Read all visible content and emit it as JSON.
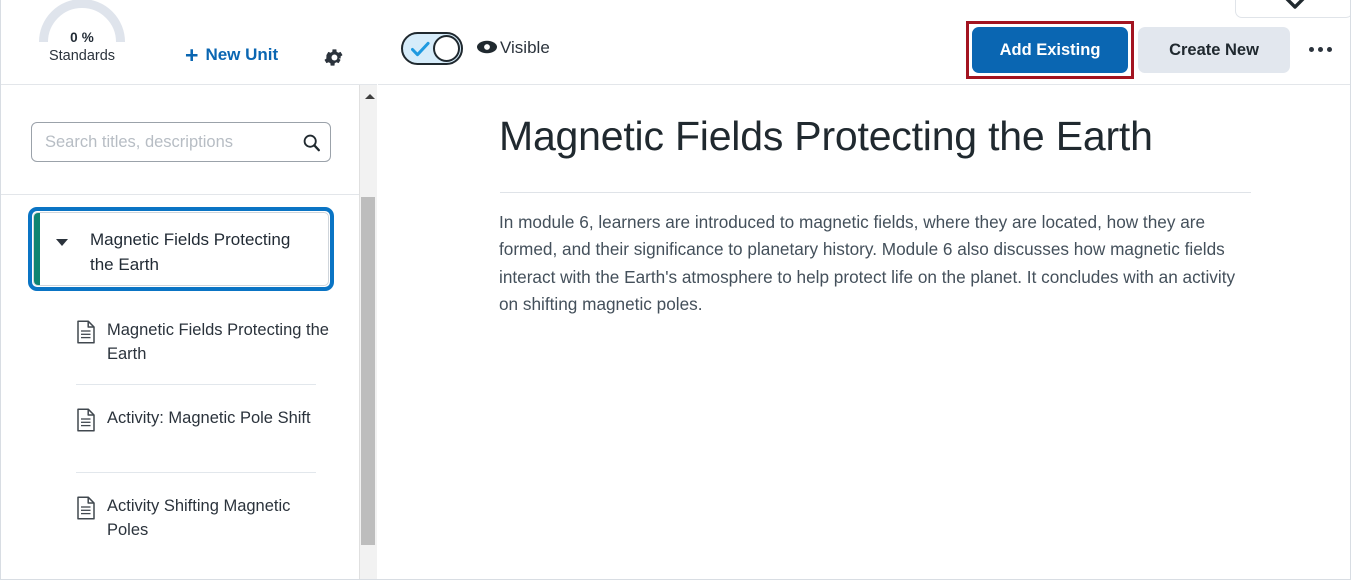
{
  "left_panel": {
    "gauge": {
      "percent": "0 %",
      "label": "Standards",
      "icon": "progress-arc-icon"
    },
    "new_unit_button": {
      "label": "New Unit",
      "icon": "plus-icon"
    },
    "settings_icon": "gear-icon",
    "search": {
      "placeholder": "Search titles, descriptions",
      "value": "",
      "icon": "search-icon"
    },
    "scrollbar": {
      "up_icon": "caret-up-icon"
    },
    "unit": {
      "label": "Magnetic Fields Protecting the Earth",
      "caret_icon": "caret-down-icon",
      "accent_color": "#0e8472",
      "selected": true
    },
    "children": [
      {
        "label": "Magnetic Fields Protecting the Earth",
        "icon": "document-icon"
      },
      {
        "label": "Activity: Magnetic Pole Shift",
        "icon": "document-icon"
      },
      {
        "label": "Activity Shifting Magnetic Poles",
        "icon": "document-icon"
      }
    ]
  },
  "right_panel": {
    "toolbar": {
      "visibility_toggle": {
        "state": "on",
        "check_icon": "check-icon"
      },
      "visibility_icon": "eye-icon",
      "visibility_label": "Visible",
      "top_dropdown_icon": "chevron-down-icon",
      "add_existing_label": "Add Existing",
      "create_new_label": "Create New",
      "more_actions_icon": "ellipsis-icon"
    },
    "content": {
      "title": "Magnetic Fields Protecting the Earth",
      "body": "In module 6, learners are introduced to magnetic fields, where they are located, how they are formed, and their significance to planetary history. Module 6 also discusses how magnetic fields interact with the Earth's atmosphere to help protect life on the planet. It concludes with an activity on shifting magnetic poles."
    }
  },
  "colors": {
    "primary_blue": "#0a66b2",
    "focus_ring_blue": "#0a74c4",
    "highlight_red": "#a31420",
    "unit_accent_teal": "#0e8472",
    "secondary_button_bg": "#e2e7ee",
    "toggle_on_bg": "#d6ecfa"
  }
}
